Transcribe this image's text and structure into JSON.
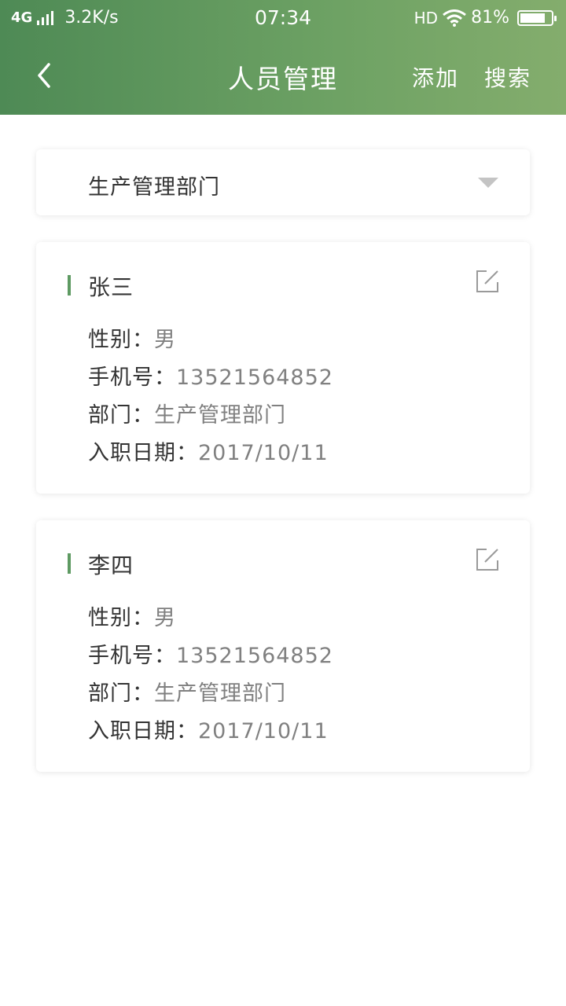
{
  "status_bar": {
    "network": "4G",
    "speed": "3.2K/s",
    "time": "07:34",
    "hd": "HD",
    "battery_percent": "81%",
    "battery_level": 0.81,
    "icons": [
      "signal-icon",
      "wifi-icon",
      "battery-icon"
    ]
  },
  "nav": {
    "title": "人员管理",
    "add_label": "添加",
    "search_label": "搜索",
    "back_icon": "chevron-left-icon"
  },
  "colors": {
    "header_gradient": [
      "#4e8a55",
      "#84ad6d"
    ],
    "accent": "#5e9a62"
  },
  "department_select": {
    "value": "生产管理部门",
    "icon": "caret-down-icon"
  },
  "people": [
    {
      "name": "张三",
      "gender_label": "性别：",
      "gender": "男",
      "phone_label": "手机号：",
      "phone": "13521564852",
      "dept_label": "部门：",
      "dept": "生产管理部门",
      "date_label": "入职日期：",
      "date": "2017/10/11"
    },
    {
      "name": "李四",
      "gender_label": "性别：",
      "gender": "男",
      "phone_label": "手机号：",
      "phone": "13521564852",
      "dept_label": "部门：",
      "dept": "生产管理部门",
      "date_label": "入职日期：",
      "date": "2017/10/11"
    }
  ]
}
